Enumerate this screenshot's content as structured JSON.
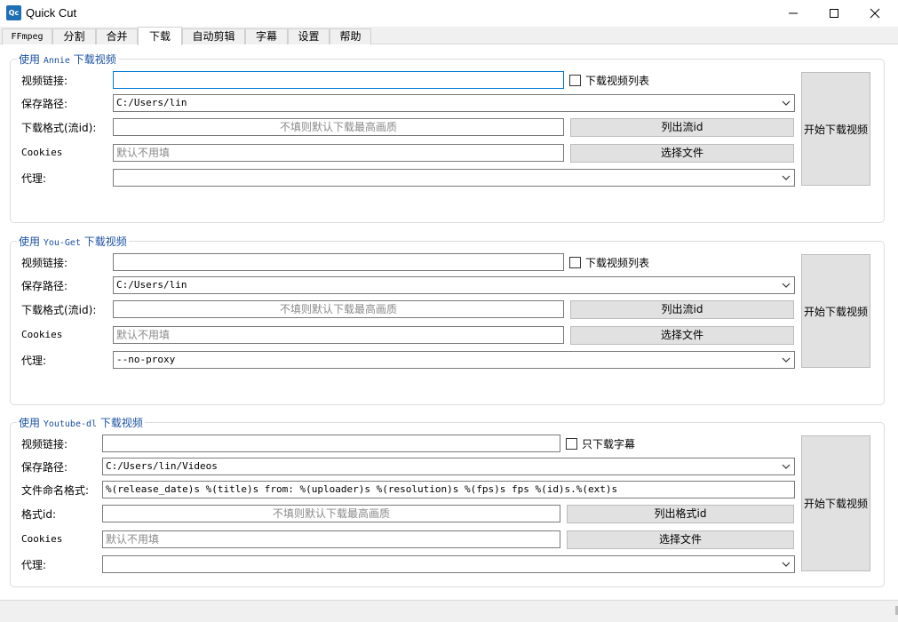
{
  "window": {
    "title": "Quick Cut",
    "icon_text": "Qc"
  },
  "tabs": [
    {
      "label": "FFmpeg",
      "active": false
    },
    {
      "label": "分割",
      "active": false
    },
    {
      "label": "合并",
      "active": false
    },
    {
      "label": "下载",
      "active": true
    },
    {
      "label": "自动剪辑",
      "active": false
    },
    {
      "label": "字幕",
      "active": false
    },
    {
      "label": "设置",
      "active": false
    },
    {
      "label": "帮助",
      "active": false
    }
  ],
  "annie": {
    "title_prefix": "使用 ",
    "title_tool": "Annie",
    "title_suffix": " 下载视频",
    "url_label": "视频链接:",
    "url_value": "",
    "playlist_label": "下载视频列表",
    "save_label": "保存路径:",
    "save_value": "C:/Users/lin",
    "format_label": "下载格式(流id):",
    "format_placeholder": "不填则默认下载最高画质",
    "list_button": "列出流id",
    "cookies_label": "Cookies",
    "cookies_placeholder": "默认不用填",
    "choose_file_button": "选择文件",
    "proxy_label": "代理:",
    "proxy_value": "",
    "start_button": "开始下载视频"
  },
  "youget": {
    "title_prefix": "使用 ",
    "title_tool": "You-Get",
    "title_suffix": " 下载视频",
    "url_label": "视频链接:",
    "url_value": "",
    "playlist_label": "下载视频列表",
    "save_label": "保存路径:",
    "save_value": "C:/Users/lin",
    "format_label": "下载格式(流id):",
    "format_placeholder": "不填则默认下载最高画质",
    "list_button": "列出流id",
    "cookies_label": "Cookies",
    "cookies_placeholder": "默认不用填",
    "choose_file_button": "选择文件",
    "proxy_label": "代理:",
    "proxy_value": "--no-proxy",
    "start_button": "开始下载视频"
  },
  "youtubedl": {
    "title_prefix": "使用 ",
    "title_tool": "Youtube-dl",
    "title_suffix": " 下载视频",
    "url_label": "视频链接:",
    "url_value": "",
    "subtitle_only_label": "只下载字幕",
    "save_label": "保存路径:",
    "save_value": "C:/Users/lin/Videos",
    "naming_label": "文件命名格式:",
    "naming_value": "%(release_date)s %(title)s from: %(uploader)s %(resolution)s %(fps)s fps %(id)s.%(ext)s",
    "format_label": "格式id:",
    "format_placeholder": "不填则默认下载最高画质",
    "list_button": "列出格式id",
    "cookies_label": "Cookies",
    "cookies_placeholder": "默认不用填",
    "choose_file_button": "选择文件",
    "proxy_label": "代理:",
    "proxy_value": "",
    "start_button": "开始下载视频"
  },
  "colors": {
    "group_title": "#1a50a3",
    "focus_border": "#0078d7",
    "button_bg": "#e1e1e1"
  }
}
